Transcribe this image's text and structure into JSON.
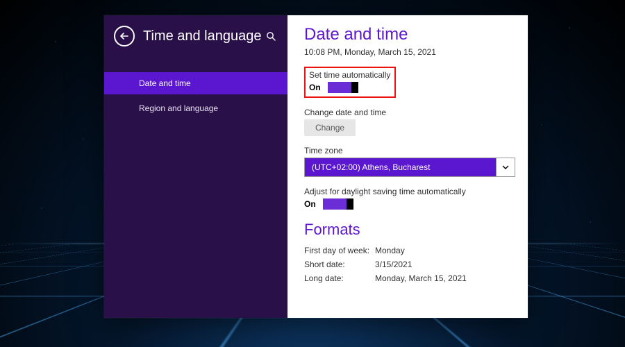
{
  "sidebar": {
    "title": "Time and language",
    "items": [
      {
        "label": "Date and time",
        "active": true
      },
      {
        "label": "Region and language",
        "active": false
      }
    ]
  },
  "main": {
    "heading": "Date and time",
    "current_datetime": "10:08 PM, Monday, March 15, 2021",
    "set_time_auto": {
      "label": "Set time automatically",
      "state": "On"
    },
    "change_dt": {
      "label": "Change date and time",
      "button": "Change"
    },
    "timezone": {
      "label": "Time zone",
      "value": "(UTC+02:00) Athens, Bucharest"
    },
    "dst": {
      "label": "Adjust for daylight saving time automatically",
      "state": "On"
    },
    "formats": {
      "heading": "Formats",
      "rows": [
        {
          "k": "First day of week:",
          "v": "Monday"
        },
        {
          "k": "Short date:",
          "v": "3/15/2021"
        },
        {
          "k": "Long date:",
          "v": "Monday, March 15, 2021"
        }
      ]
    }
  },
  "colors": {
    "accent": "#5b16cf",
    "sidebar_bg": "#2a1048"
  }
}
